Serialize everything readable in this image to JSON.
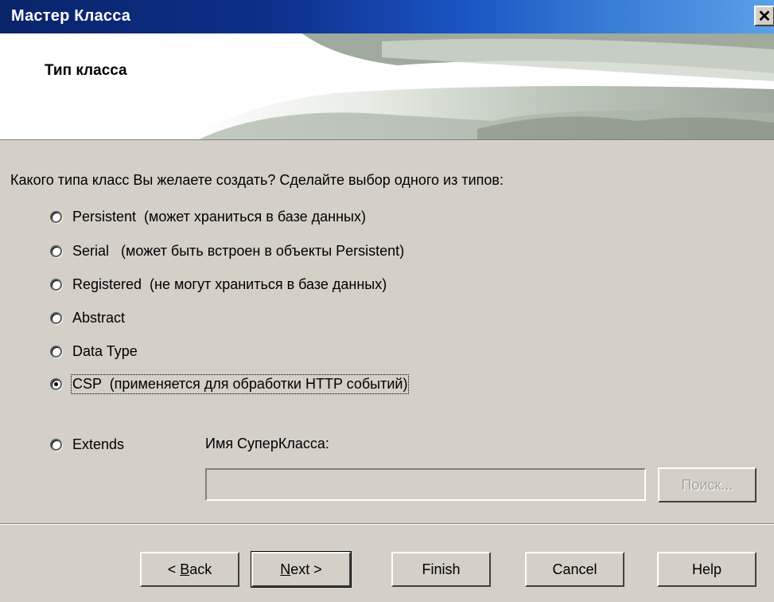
{
  "window": {
    "title": "Мастер Класса",
    "close_glyph": "✕"
  },
  "header": {
    "title": "Тип класса"
  },
  "question": "Какого типа класс Вы желаете создать? Сделайте выбор одного из типов:",
  "options": [
    {
      "label": "Persistent  (может храниться в базе данных)",
      "selected": false
    },
    {
      "label": "Serial   (может быть встроен в объекты Persistent)",
      "selected": false
    },
    {
      "label": "Registered  (не могут храниться в базе данных)",
      "selected": false
    },
    {
      "label": "Abstract",
      "selected": false
    },
    {
      "label": "Data Type",
      "selected": false
    },
    {
      "label": "CSP  (применяется для обработки HTTP событий)",
      "selected": true
    }
  ],
  "extends": {
    "label": "Extends",
    "selected": false
  },
  "superclass": {
    "label": "Имя СуперКласса:",
    "value": "",
    "search_label": "Поиск..."
  },
  "buttons": {
    "back_prefix": "< ",
    "back_mnemonic": "B",
    "back_rest": "ack",
    "next_mnemonic": "N",
    "next_rest": "ext >",
    "finish": "Finish",
    "cancel": "Cancel",
    "help": "Help"
  }
}
